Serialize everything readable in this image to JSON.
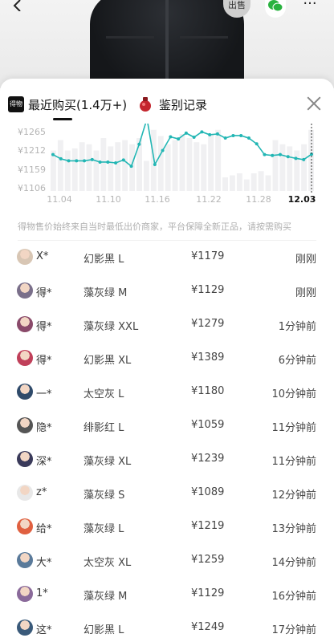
{
  "header": {
    "sell_label": "出售",
    "back_icon": "back-chevron-icon",
    "wechat_icon": "wechat-icon",
    "more_label": "···"
  },
  "tabs": [
    {
      "logo": "得物",
      "label": "最近购买(1.4万+)",
      "active": true
    },
    {
      "label": "鉴别记录",
      "active": false
    }
  ],
  "chart_data": {
    "type": "line",
    "y_ticks": [
      "¥1265",
      "¥1212",
      "¥1159",
      "¥1106"
    ],
    "x_ticks": [
      "11.04",
      "11.10",
      "11.16",
      "11.22",
      "11.28",
      "12.03"
    ],
    "selected_x": "12.03",
    "ylim": [
      1106,
      1265
    ],
    "line_color": "#22b6b4",
    "bar_color": "#f0f0f2",
    "series": [
      {
        "values": [
          1190,
          1180,
          1175,
          1175,
          1175,
          1178,
          1172,
          1172,
          1170,
          1177,
          1162,
          1215,
          1280,
          1166,
          1200,
          1233,
          1228,
          1242,
          1232,
          1245,
          1238,
          1240,
          1230,
          1236,
          1236,
          1230,
          1216,
          1190,
          1188,
          1190,
          1185,
          1181,
          1178,
          1191
        ]
      }
    ],
    "bars": [
      1200,
      1225,
      1200,
      1205,
      1220,
      1215,
      1200,
      1230,
      1210,
      1220,
      1225,
      1215,
      1230,
      1175,
      1250,
      1235,
      1215,
      1225,
      1240,
      1230,
      1220,
      1215,
      1240,
      1250,
      1135,
      1140,
      1145,
      1130,
      1145,
      1150,
      1140,
      1225,
      1215,
      1210,
      1200,
      1215,
      1250
    ]
  },
  "disclaimer": "得物售价始终来自当时最低出价商家，平台保障全新正品，请按需购买",
  "purchases": [
    {
      "user": "X*",
      "variant": "幻影黑 L",
      "price": "¥1179",
      "time": "刚刚",
      "avatar_color": "#d8c6b4"
    },
    {
      "user": "得*",
      "variant": "藻灰绿 M",
      "price": "¥1129",
      "time": "刚刚",
      "avatar_color": "#7a6f8a"
    },
    {
      "user": "得*",
      "variant": "藻灰绿 XXL",
      "price": "¥1279",
      "time": "1分钟前",
      "avatar_color": "#8a4a6a"
    },
    {
      "user": "得*",
      "variant": "幻影黑 XL",
      "price": "¥1389",
      "time": "6分钟前",
      "avatar_color": "#c0405a"
    },
    {
      "user": "一*",
      "variant": "太空灰 L",
      "price": "¥1180",
      "time": "10分钟前",
      "avatar_color": "#2f4a6a"
    },
    {
      "user": "隐*",
      "variant": "绯影红 L",
      "price": "¥1059",
      "time": "11分钟前",
      "avatar_color": "#555555"
    },
    {
      "user": "深*",
      "variant": "藻灰绿 XL",
      "price": "¥1239",
      "time": "11分钟前",
      "avatar_color": "#3a3a5a"
    },
    {
      "user": "z*",
      "variant": "藻灰绿 S",
      "price": "¥1089",
      "time": "12分钟前",
      "avatar_color": "#e8e8e8"
    },
    {
      "user": "给*",
      "variant": "藻灰绿 L",
      "price": "¥1219",
      "time": "13分钟前",
      "avatar_color": "#e06040"
    },
    {
      "user": "大*",
      "variant": "太空灰 XL",
      "price": "¥1259",
      "time": "14分钟前",
      "avatar_color": "#5a7a9a"
    },
    {
      "user": "1*",
      "variant": "藻灰绿 M",
      "price": "¥1129",
      "time": "16分钟前",
      "avatar_color": "#8a6a9a"
    },
    {
      "user": "这*",
      "variant": "幻影黑 L",
      "price": "¥1249",
      "time": "17分钟前",
      "avatar_color": "#3a5a7a"
    }
  ]
}
